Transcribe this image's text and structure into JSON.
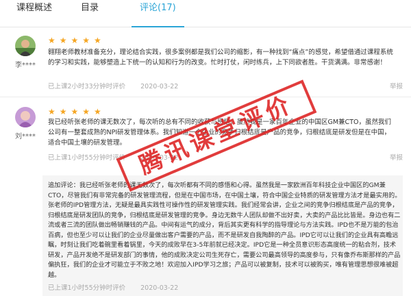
{
  "tabs": [
    {
      "label": "课程概述"
    },
    {
      "label": "目录"
    },
    {
      "label": "评论(17)"
    }
  ],
  "colors": {
    "accent": "#2aa4d6",
    "star": "#f5a623",
    "stamp": "#dd2222"
  },
  "reviews": [
    {
      "user": "李****",
      "stars": "★★★★★",
      "text": "翱翔老师教材准备充分，理论结合实践，很多案例都是我们公司的缩影，有一种找到“痛点”的感觉，希望借通过课程系统的学习和实践，能够塑造上下统一的认知和行为的改变。忙时打仗，闲时练兵，上下同欲者胜。干货满满。非常感谢！",
      "time": "已上课2小时33分钟时评价",
      "date": "2020-03-22",
      "report": "举报"
    },
    {
      "user": "刘****",
      "stars": "★★★★★",
      "text": "我已经听张老师的课无数次了，每次听的总有不同的收获与感悟。虽然我是一家百年企业的中国区GM兼CTO，虽然我们公司有一整套成熟的NPI研发管理体系。我们知道一个企业的竞争归根结底是产品的竞争，归根结底是研发但是在中国，适合中国土壤的研发管理。",
      "time": "已上课1小时55分钟时评价",
      "date": "2020-03-22",
      "report": "举报",
      "followup": {
        "text": "追加评论：我已经听张老师的课无数次了，每次听都有不同的感悟和心得。虽然我是一家欧洲百年科技企业中国区的GM兼CTO，尽管我们有非常完备的研发管理流程，但是在中国市场，在中国土壤，符合中国企业特质的研发管理方法才是最实用的。张老师的IPD管理方法，无疑是最具实践性可操作性的研发管理实践。我们经常会讲，企业之间的竞争归根结底是产品的竞争，归根结底是研发团队的竞争，归根结底是研发管理的竞争。身边无数牛人团队却做不出好卖，大卖的产品比比皆是。身边也有二流或者三流的团队做出畅销赚钱的产品。中间有运气的成分，背后其实更有科学的指导理论与方法实践。IPD也不是万能的包治百病，但也至少可以让我们的企业尽量做出客户需要的产品，而不是研发自我陶醉的产品。IPD它可以让我们的企业具有高瞻远瞩，时刻让我们吃着碗里看着锅里，今天的成败早在3-5年前就已经决定。IPD它是一种全员意识形态高度统一的粘合剂，技术研发，产品开发绝不是研发部门的事情，他的成败决定公司生死存亡，需要公司最高领导的高度参与，只有像乔布斯那样的产品偏执狂，我们的企业才可能立于不败之地！欢迎加入IPD学习之旅；产品可以被复制，技术可以被购买，唯有管理思想很难被超越。",
        "time": "已上课1小时55分钟时评价",
        "date": "2020-03-22"
      }
    }
  ],
  "stamp": {
    "text": "腾讯课堂评价"
  }
}
